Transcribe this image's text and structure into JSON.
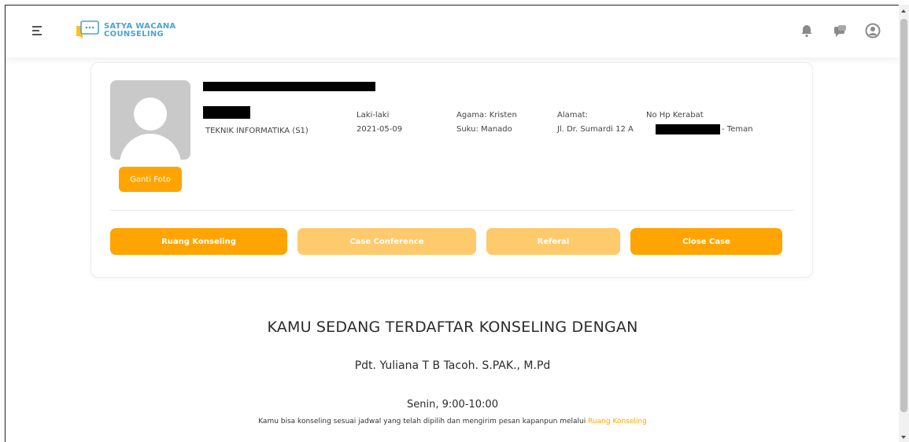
{
  "header": {
    "logo_line1": "SATYA WACANA",
    "logo_line2": "COUNSELING",
    "brand_color": "#4aa3d8",
    "icons": [
      "menu-icon",
      "bell-icon",
      "chat-icon",
      "user-icon"
    ]
  },
  "profile": {
    "photo_button": "Ganti Foto",
    "program": "TEKNIK INFORMATIKA (S1)",
    "gender": "Laki-laki",
    "date": "2021-05-09",
    "religion": "Agama: Kristen",
    "ethnicity": "Suku: Manado",
    "address_label": "Alamat:",
    "address": "Jl. Dr. Sumardi 12 A",
    "relative_label": "No Hp Kerabat",
    "relative_relation": "- Teman"
  },
  "actions": {
    "ruang": "Ruang Konseling",
    "case_conference": "Case Conference",
    "referal": "Referal",
    "close_case": "Close Case"
  },
  "info": {
    "heading": "KAMU SEDANG TERDAFTAR KONSELING DENGAN",
    "counselor": "Pdt. Yuliana T B Tacoh. S.PAK., M.Pd",
    "schedule": "Senin, 9:00-10:00",
    "note_text": "Kamu bisa konseling sesuai jadwal yang telah dipilih dan mengirim pesan kapanpun melalui",
    "note_link": "Ruang Konseling"
  },
  "colors": {
    "accent": "#ffa400",
    "accent_faded": "#ffca6b"
  }
}
